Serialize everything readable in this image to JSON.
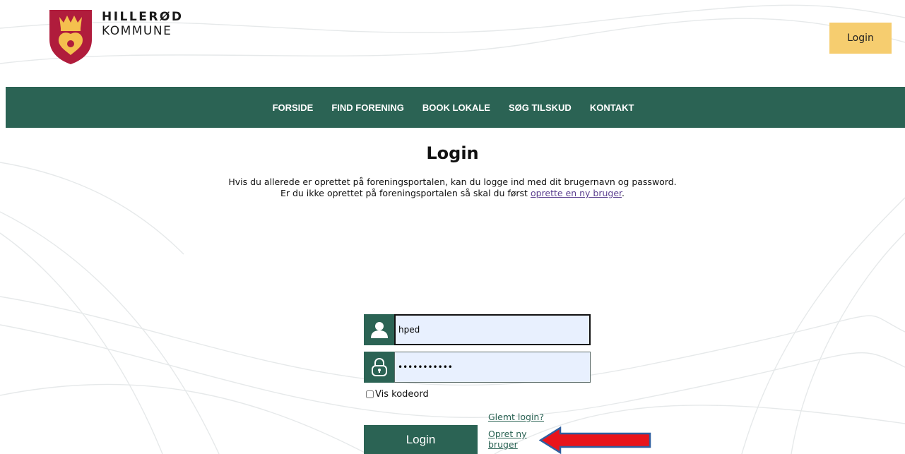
{
  "header": {
    "logo_line1": "HILLERØD",
    "logo_line2": "KOMMUNE",
    "login_button": "Login"
  },
  "nav": {
    "items": [
      "FORSIDE",
      "FIND FORENING",
      "BOOK LOKALE",
      "SØG TILSKUD",
      "KONTAKT"
    ]
  },
  "main": {
    "title": "Login",
    "intro_line1": "Hvis du allerede er oprettet på foreningsportalen, kan du logge ind med dit brugernavn og password.",
    "intro_line2_prefix": "Er du ikke oprettet på foreningsportalen så skal du først ",
    "intro_link": "oprette en ny bruger",
    "intro_line2_suffix": "."
  },
  "form": {
    "username_value": "hped",
    "password_value": "•••••••••••",
    "show_password_label": "Vis kodeord",
    "forgot_login": "Glemt login?",
    "create_user": "Opret ny bruger",
    "login_button": "Login"
  },
  "colors": {
    "brand_green": "#2b6354",
    "accent_yellow": "#f6cd6f",
    "input_bg": "#e8f0fe",
    "arrow_red": "#e8141b",
    "arrow_outline": "#2f5fa0",
    "logo_red": "#b01c3c"
  },
  "icons": {
    "username": "user-icon",
    "password": "lock-icon",
    "annotation": "arrow-left-icon"
  }
}
